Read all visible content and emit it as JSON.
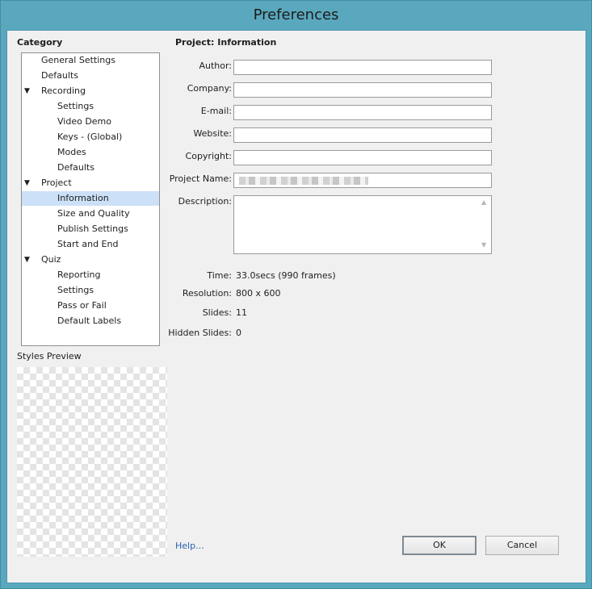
{
  "window": {
    "title": "Preferences"
  },
  "category": {
    "heading": "Category",
    "items": [
      {
        "label": "General Settings",
        "level": 1
      },
      {
        "label": "Defaults",
        "level": 1
      },
      {
        "label": "Recording",
        "level": 1,
        "expanded": true
      },
      {
        "label": "Settings",
        "level": 2
      },
      {
        "label": "Video Demo",
        "level": 2
      },
      {
        "label": "Keys - (Global)",
        "level": 2
      },
      {
        "label": "Modes",
        "level": 2
      },
      {
        "label": "Defaults",
        "level": 2
      },
      {
        "label": "Project",
        "level": 1,
        "expanded": true
      },
      {
        "label": "Information",
        "level": 2,
        "selected": true
      },
      {
        "label": "Size and Quality",
        "level": 2
      },
      {
        "label": "Publish Settings",
        "level": 2
      },
      {
        "label": "Start and End",
        "level": 2
      },
      {
        "label": "Quiz",
        "level": 1,
        "expanded": true
      },
      {
        "label": "Reporting",
        "level": 2
      },
      {
        "label": "Settings",
        "level": 2
      },
      {
        "label": "Pass or Fail",
        "level": 2
      },
      {
        "label": "Default Labels",
        "level": 2
      }
    ],
    "arrow_glyph": "▼"
  },
  "styles_preview": {
    "label": "Styles Preview"
  },
  "panel": {
    "heading": "Project: Information",
    "fields": {
      "author": {
        "label": "Author:",
        "value": ""
      },
      "company": {
        "label": "Company:",
        "value": ""
      },
      "email": {
        "label": "E-mail:",
        "value": ""
      },
      "website": {
        "label": "Website:",
        "value": ""
      },
      "copyright": {
        "label": "Copyright:",
        "value": ""
      },
      "project_name": {
        "label": "Project Name:",
        "value": ""
      },
      "description": {
        "label": "Description:",
        "value": ""
      }
    },
    "info": {
      "time": {
        "label": "Time:",
        "value": "33.0secs (990 frames)"
      },
      "resolution": {
        "label": "Resolution:",
        "value": "800 x 600"
      },
      "slides": {
        "label": "Slides:",
        "value": "11"
      },
      "hidden_slides": {
        "label": "Hidden Slides:",
        "value": "0"
      }
    }
  },
  "footer": {
    "help_label": "Help...",
    "ok_label": "OK",
    "cancel_label": "Cancel"
  },
  "colors": {
    "frame": "#5aa8be",
    "selection": "#cce0f7",
    "link": "#2a63b0"
  }
}
